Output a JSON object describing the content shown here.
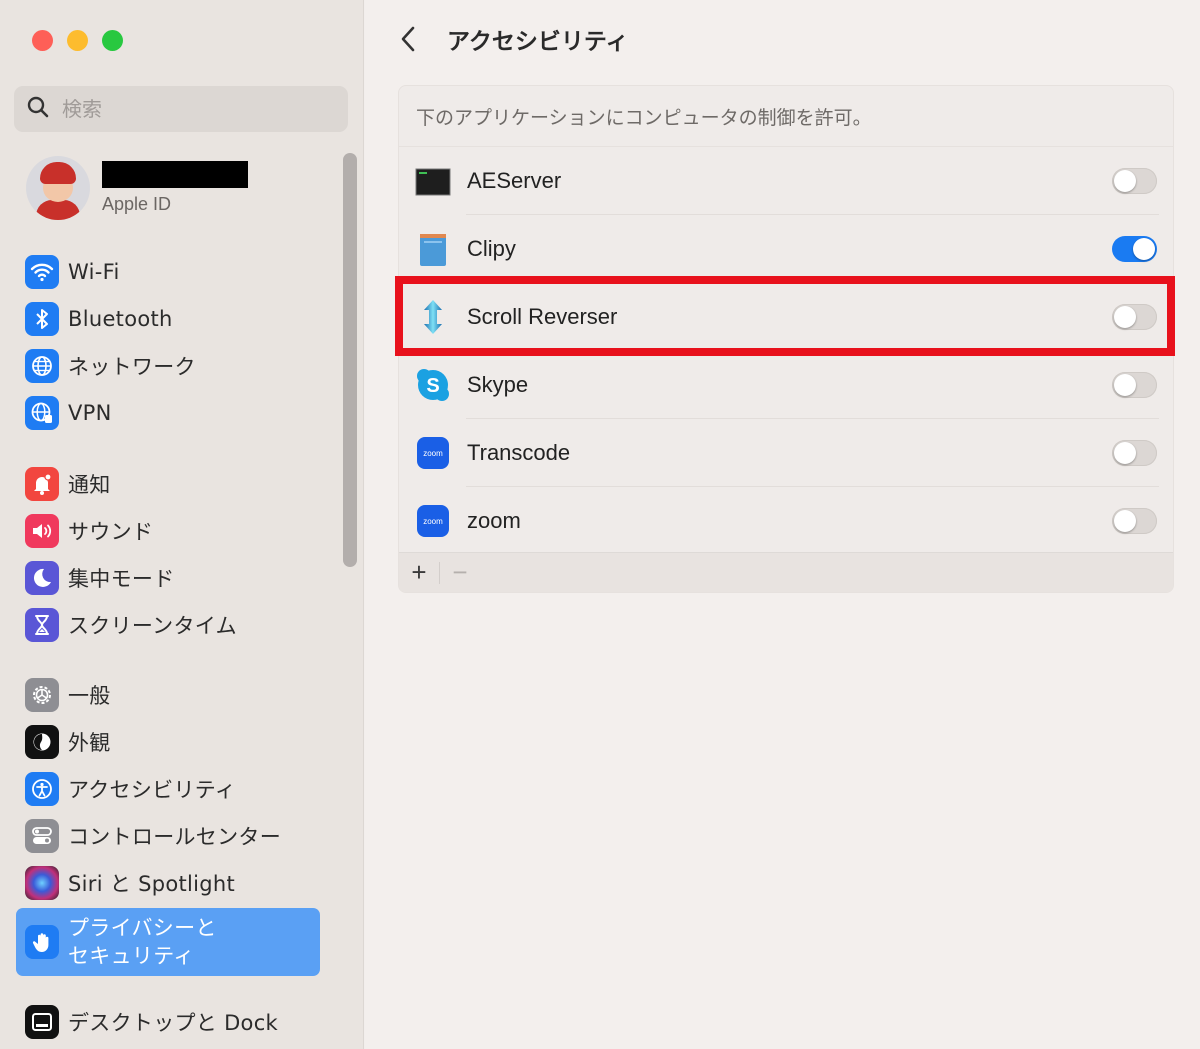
{
  "window": {
    "controls": [
      "close",
      "minimize",
      "zoom"
    ]
  },
  "sidebar": {
    "search": {
      "placeholder": "検索",
      "value": ""
    },
    "account": {
      "name": "[redacted]",
      "label": "Apple ID"
    },
    "items": [
      {
        "label": "Wi-Fi",
        "icon": "wifi-icon",
        "color": "#1f7cf3"
      },
      {
        "label": "Bluetooth",
        "icon": "bluetooth-icon",
        "color": "#1f7cf3"
      },
      {
        "label": "ネットワーク",
        "icon": "globe-icon",
        "color": "#1f7cf3"
      },
      {
        "label": "VPN",
        "icon": "vpn-globe-icon",
        "color": "#1f7cf3"
      },
      {
        "label": "通知",
        "icon": "bell-icon",
        "color": "#f2463f"
      },
      {
        "label": "サウンド",
        "icon": "speaker-icon",
        "color": "#f0395d"
      },
      {
        "label": "集中モード",
        "icon": "moon-icon",
        "color": "#5a56d6"
      },
      {
        "label": "スクリーンタイム",
        "icon": "hourglass-icon",
        "color": "#5a56d6"
      },
      {
        "label": "一般",
        "icon": "gear-icon",
        "color": "#8e8e93"
      },
      {
        "label": "外観",
        "icon": "appearance-icon",
        "color": "#111111"
      },
      {
        "label": "アクセシビリティ",
        "icon": "accessibility-icon",
        "color": "#1f7cf3"
      },
      {
        "label": "コントロールセンター",
        "icon": "control-center-icon",
        "color": "#8e8e93"
      },
      {
        "label": "Siri と Spotlight",
        "icon": "siri-icon",
        "color": "#6a2b8c"
      },
      {
        "label": "プライバシーと\nセキュリティ",
        "icon": "hand-icon",
        "color": "#1f7cf3",
        "selected": true
      },
      {
        "label": "デスクトップと Dock",
        "icon": "dock-icon",
        "color": "#111111"
      }
    ]
  },
  "main": {
    "back_label": "戻る",
    "title": "アクセシビリティ",
    "description": "下のアプリケーションにコンピュータの制御を許可。",
    "apps": [
      {
        "name": "AEServer",
        "icon": "terminal-icon",
        "enabled": false
      },
      {
        "name": "Clipy",
        "icon": "clipy-icon",
        "enabled": true
      },
      {
        "name": "Scroll Reverser",
        "icon": "scroll-arrows-icon",
        "enabled": false,
        "highlighted": true
      },
      {
        "name": "Skype",
        "icon": "skype-icon",
        "enabled": false
      },
      {
        "name": "Transcode",
        "icon": "zoom-app-icon",
        "enabled": false
      },
      {
        "name": "zoom",
        "icon": "zoom-app-icon",
        "enabled": false
      }
    ],
    "footer": {
      "add_label": "+",
      "remove_label": "−"
    },
    "highlight_color": "#e8111c",
    "accent_color": "#1a7bf2"
  }
}
